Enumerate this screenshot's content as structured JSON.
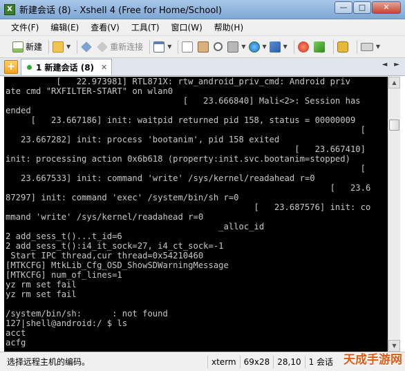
{
  "window": {
    "title": "新建会话 (8) - Xshell 4 (Free for Home/School)",
    "app_icon_glyph": "X",
    "minimize_glyph": "—",
    "maximize_glyph": "□",
    "close_glyph": "✕"
  },
  "menu": {
    "items": [
      "文件(F)",
      "编辑(E)",
      "查看(V)",
      "工具(T)",
      "窗口(W)",
      "帮助(H)"
    ]
  },
  "toolbar": {
    "new_label": "新建",
    "reconnect_label": "重新连接"
  },
  "tabs": {
    "add_glyph": "+",
    "active_label": "1 新建会话 (8)",
    "close_glyph": "✕",
    "nav_left": "◄",
    "nav_right": "►"
  },
  "terminal": {
    "lines": [
      "          [   22.973981] RTL871X: rtw_android_priv_cmd: Android priv",
      "ate cmd \"RXFILTER-START\" on wlan0",
      "                                   [   23.666840] Mali<2>: Session has",
      "ended",
      "     [   23.667186] init: waitpid returned pid 158, status = 00000009",
      "                                                                      [",
      "   23.667282] init: process 'bootanim', pid 158 exited",
      "                                                         [   23.667410]",
      "init: processing action 0x6b618 (property:init.svc.bootanim=stopped)",
      "                                                                      [",
      "   23.667533] init: command 'write' /sys/kernel/readahead r=0",
      "                                                                [   23.6",
      "87297] init: command 'exec' /system/bin/sh r=0",
      "                                                 [   23.687576] init: co",
      "mmand 'write' /sys/kernel/readahead r=0",
      "                                          _alloc_id",
      "2 add_sess_t()...t_id=6",
      "2 add_sess_t():i4_it_sock=27, i4_ct_sock=-1",
      " Start IPC thread,cur thread=0x54210460",
      "[MTKCFG] MtkLib_Cfg_OSD_ShowSDWarningMessage",
      "[MTKCFG] num_of_lines=1",
      "yz rm set fail",
      "yz rm set fail",
      "",
      "/system/bin/sh:      : not found",
      "127|shell@android:/ $ ls",
      "acct",
      "acfg"
    ]
  },
  "scrollbar": {
    "up_glyph": "▲",
    "down_glyph": "▼"
  },
  "status": {
    "message": "选择远程主机的编码。",
    "terminal_type": "xterm",
    "size": "69x28",
    "cursor": "28,10",
    "sessions": "1 会话"
  },
  "watermark": {
    "text": "天成手游网"
  },
  "colors": {
    "terminal_bg": "#000000",
    "terminal_fg": "#c8c8c8",
    "title_bar": "#7ea6d4",
    "tab_active_dot": "#35a53a",
    "watermark": "#e15a14"
  }
}
